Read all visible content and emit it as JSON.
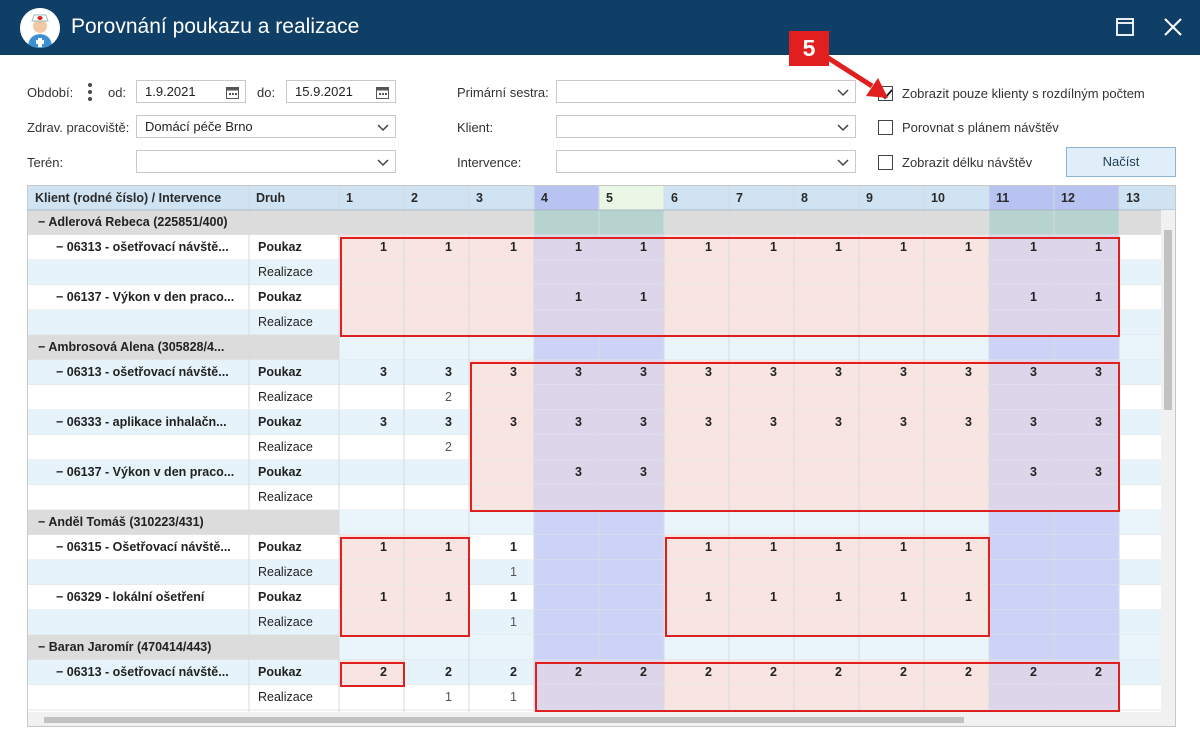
{
  "window": {
    "title": "Porovnání poukazu a realizace"
  },
  "filters": {
    "period_label": "Období:",
    "from_label": "od:",
    "from_value": "1.9.2021",
    "to_label": "do:",
    "to_value": "15.9.2021",
    "workplace_label": "Zdrav. pracoviště:",
    "workplace_value": "Domácí péče Brno",
    "terrain_label": "Terén:",
    "terrain_value": "",
    "nurse_label": "Primární sestra:",
    "nurse_value": "",
    "client_label": "Klient:",
    "client_value": "",
    "intervention_label": "Intervence:",
    "intervention_value": ""
  },
  "options": {
    "only_diff": {
      "label": "Zobrazit pouze klienty s rozdílným počtem",
      "checked": true
    },
    "compare_plan": {
      "label": "Porovnat s plánem návštěv",
      "checked": false
    },
    "show_length": {
      "label": "Zobrazit délku návštěv",
      "checked": false
    }
  },
  "load_button": "Načíst",
  "annotation": {
    "step": "5"
  },
  "grid": {
    "col_client": "Klient (rodné číslo) / Intervence",
    "col_druh": "Druh",
    "days": [
      "1",
      "2",
      "3",
      "4",
      "5",
      "6",
      "7",
      "8",
      "9",
      "10",
      "11",
      "12",
      "13"
    ],
    "weekend_days": [
      "4",
      "5",
      "11",
      "12"
    ],
    "today_day": "5",
    "rows": [
      {
        "type": "client",
        "label": "Adlerová Rebeca (225851/400)"
      },
      {
        "type": "pouk",
        "label": "06313 - ošetřovací návště...",
        "druh": "Poukaz",
        "vals": [
          "1",
          "1",
          "1",
          "1",
          "1",
          "1",
          "1",
          "1",
          "1",
          "1",
          "1",
          "1",
          ""
        ]
      },
      {
        "type": "real",
        "label": "",
        "druh": "Realizace",
        "vals": [
          "",
          "",
          "",
          "",
          "",
          "",
          "",
          "",
          "",
          "",
          "",
          "",
          ""
        ]
      },
      {
        "type": "pouk",
        "label": "06137 - Výkon v den praco...",
        "druh": "Poukaz",
        "vals": [
          "",
          "",
          "",
          "1",
          "1",
          "",
          "",
          "",
          "",
          "",
          "1",
          "1",
          ""
        ]
      },
      {
        "type": "real",
        "label": "",
        "druh": "Realizace",
        "vals": [
          "",
          "",
          "",
          "",
          "",
          "",
          "",
          "",
          "",
          "",
          "",
          "",
          ""
        ]
      },
      {
        "type": "client",
        "label": "Ambrosová Alena (305828/4..."
      },
      {
        "type": "pouk",
        "label": "06313 - ošetřovací návště...",
        "druh": "Poukaz",
        "vals": [
          "3",
          "3",
          "3",
          "3",
          "3",
          "3",
          "3",
          "3",
          "3",
          "3",
          "3",
          "3",
          ""
        ]
      },
      {
        "type": "real",
        "label": "",
        "druh": "Realizace",
        "vals": [
          "",
          "2",
          "",
          "",
          "",
          "",
          "",
          "",
          "",
          "",
          "",
          "",
          ""
        ]
      },
      {
        "type": "pouk",
        "label": "06333 - aplikace inhalačn...",
        "druh": "Poukaz",
        "vals": [
          "3",
          "3",
          "3",
          "3",
          "3",
          "3",
          "3",
          "3",
          "3",
          "3",
          "3",
          "3",
          ""
        ]
      },
      {
        "type": "real",
        "label": "",
        "druh": "Realizace",
        "vals": [
          "",
          "2",
          "",
          "",
          "",
          "",
          "",
          "",
          "",
          "",
          "",
          "",
          ""
        ]
      },
      {
        "type": "pouk",
        "label": "06137 - Výkon v den praco...",
        "druh": "Poukaz",
        "vals": [
          "",
          "",
          "",
          "3",
          "3",
          "",
          "",
          "",
          "",
          "",
          "3",
          "3",
          ""
        ]
      },
      {
        "type": "real",
        "label": "",
        "druh": "Realizace",
        "vals": [
          "",
          "",
          "",
          "",
          "",
          "",
          "",
          "",
          "",
          "",
          "",
          "",
          ""
        ]
      },
      {
        "type": "client",
        "label": "Anděl Tomáš (310223/431)"
      },
      {
        "type": "pouk",
        "label": "06315 - Ošetřovací návště...",
        "druh": "Poukaz",
        "vals": [
          "1",
          "1",
          "1",
          "",
          "",
          "1",
          "1",
          "1",
          "1",
          "1",
          "",
          "",
          ""
        ]
      },
      {
        "type": "real",
        "label": "",
        "druh": "Realizace",
        "vals": [
          "",
          "",
          "1",
          "",
          "",
          "",
          "",
          "",
          "",
          "",
          "",
          "",
          ""
        ]
      },
      {
        "type": "pouk",
        "label": "06329 - lokální ošetření",
        "druh": "Poukaz",
        "vals": [
          "1",
          "1",
          "1",
          "",
          "",
          "1",
          "1",
          "1",
          "1",
          "1",
          "",
          "",
          ""
        ]
      },
      {
        "type": "real",
        "label": "",
        "druh": "Realizace",
        "vals": [
          "",
          "",
          "1",
          "",
          "",
          "",
          "",
          "",
          "",
          "",
          "",
          "",
          ""
        ]
      },
      {
        "type": "client",
        "label": "Baran Jaromír (470414/443)"
      },
      {
        "type": "pouk",
        "label": "06313 - ošetřovací návště...",
        "druh": "Poukaz",
        "vals": [
          "2",
          "2",
          "2",
          "2",
          "2",
          "2",
          "2",
          "2",
          "2",
          "2",
          "2",
          "2",
          ""
        ]
      },
      {
        "type": "real",
        "label": "",
        "druh": "Realizace",
        "vals": [
          "",
          "1",
          "1",
          "",
          "",
          "",
          "",
          "",
          "",
          "",
          "",
          "",
          ""
        ]
      }
    ]
  },
  "colors": {
    "titlebar": "#0f3f66",
    "header_bg": "#cfe3f3",
    "weekend_header": "#b9c3f2",
    "today_header": "#eaf7e6",
    "client_row": "#dcdcdc",
    "highlight_pink": "#f8e5e1",
    "highlight_weekend": "#ddd5ea",
    "weekend_plain": "#cdd3f6",
    "row_alt": "#e7f3fb",
    "annotation_red": "#e01f1f"
  }
}
